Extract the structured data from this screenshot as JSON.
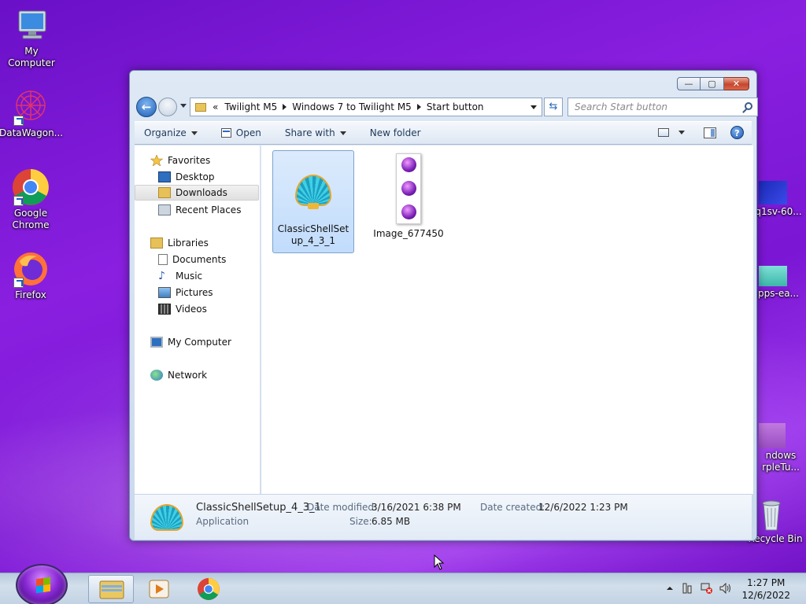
{
  "desktop": {
    "icons": [
      {
        "label": "My Computer"
      },
      {
        "label": "DataWagon..."
      },
      {
        "label": "Google Chrome"
      },
      {
        "label": "Firefox"
      },
      {
        "label": "q1sv-60..."
      },
      {
        "label": "pps-ea..."
      },
      {
        "label": "ndows rpleTu..."
      },
      {
        "label": "Recycle Bin"
      }
    ]
  },
  "window": {
    "caption_buttons": {
      "minimize": "—",
      "maximize": "▢",
      "close": "✕"
    },
    "breadcrumb": {
      "overflow": "«",
      "items": [
        "Twilight M5",
        "Windows 7 to Twilight M5",
        "Start button"
      ]
    },
    "search_placeholder": "Search Start button",
    "toolbar": {
      "organize": "Organize",
      "open": "Open",
      "share_with": "Share with",
      "new_folder": "New folder",
      "help": "?"
    },
    "nav_pane": {
      "favorites": {
        "label": "Favorites",
        "items": [
          "Desktop",
          "Downloads",
          "Recent Places"
        ],
        "selected": "Downloads"
      },
      "libraries": {
        "label": "Libraries",
        "items": [
          "Documents",
          "Music",
          "Pictures",
          "Videos"
        ]
      },
      "computer": "My Computer",
      "network": "Network"
    },
    "files": [
      {
        "name": "ClassicShellSetup_4_3_1",
        "icon": "classic-shell-icon",
        "selected": true
      },
      {
        "name": "Image_677450",
        "icon": "image-thumbnail-icon",
        "selected": false
      }
    ],
    "details": {
      "name": "ClassicShellSetup_4_3_1",
      "type": "Application",
      "date_modified_label": "Date modified:",
      "date_modified": "3/16/2021 6:38 PM",
      "size_label": "Size:",
      "size": "6.85 MB",
      "date_created_label": "Date created:",
      "date_created": "12/6/2022 1:23 PM"
    }
  },
  "taskbar": {
    "time": "1:27 PM",
    "date": "12/6/2022"
  },
  "colors": {
    "desktop_bg": "#7a16d4",
    "window_frame": "#c9d9ec",
    "selection": "#c1dcfc",
    "close_button": "#c7462d"
  }
}
